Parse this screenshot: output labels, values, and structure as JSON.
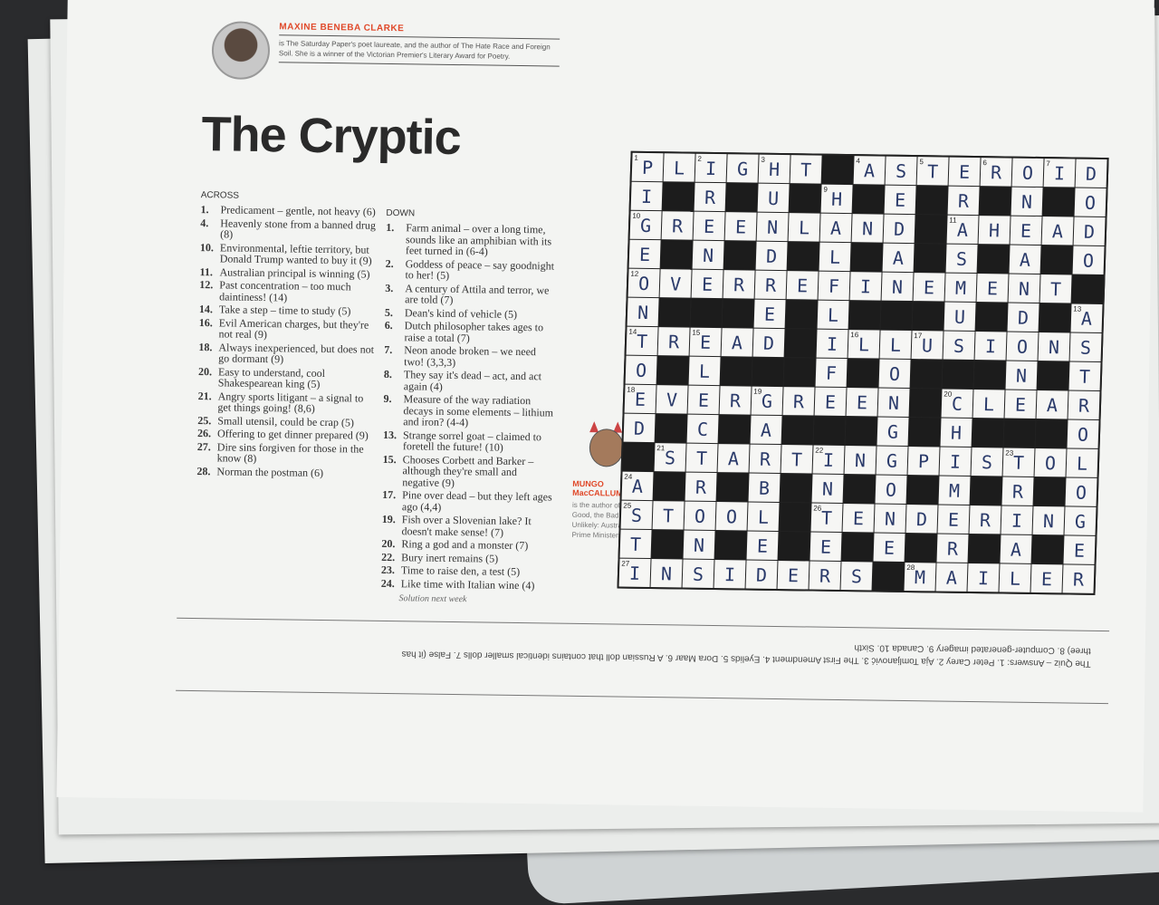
{
  "author": {
    "name": "MAXINE BENEBA CLARKE",
    "bio": "is The Saturday Paper's poet laureate, and the author of The Hate Race and Foreign Soil. She is a winner of the Victorian Premier's Literary Award for Poetry."
  },
  "title": "The Cryptic",
  "across_heading": "ACROSS",
  "down_heading": "DOWN",
  "across": [
    {
      "n": "1.",
      "t": "Predicament – gentle, not heavy (6)"
    },
    {
      "n": "4.",
      "t": "Heavenly stone from a banned drug (8)"
    },
    {
      "n": "10.",
      "t": "Environmental, leftie territory, but Donald Trump wanted to buy it (9)"
    },
    {
      "n": "11.",
      "t": "Australian principal is winning (5)"
    },
    {
      "n": "12.",
      "t": "Past concentration – too much daintiness! (14)"
    },
    {
      "n": "14.",
      "t": "Take a step – time to study (5)"
    },
    {
      "n": "16.",
      "t": "Evil American charges, but they're not real (9)"
    },
    {
      "n": "18.",
      "t": "Always inexperienced, but does not go dormant (9)"
    },
    {
      "n": "20.",
      "t": "Easy to understand, cool Shakespearean king (5)"
    },
    {
      "n": "21.",
      "t": "Angry sports litigant – a signal to get things going! (8,6)"
    },
    {
      "n": "25.",
      "t": "Small utensil, could be crap (5)"
    },
    {
      "n": "26.",
      "t": "Offering to get dinner prepared (9)"
    },
    {
      "n": "27.",
      "t": "Dire sins forgiven for those in the know (8)"
    },
    {
      "n": "28.",
      "t": "Norman the postman (6)"
    }
  ],
  "down": [
    {
      "n": "1.",
      "t": "Farm animal – over a long time, sounds like an amphibian with its feet turned in (6-4)"
    },
    {
      "n": "2.",
      "t": "Goddess of peace – say goodnight to her! (5)"
    },
    {
      "n": "3.",
      "t": "A century of Attila and terror, we are told (7)"
    },
    {
      "n": "5.",
      "t": "Dean's kind of vehicle (5)"
    },
    {
      "n": "6.",
      "t": "Dutch philosopher takes ages to raise a total (7)"
    },
    {
      "n": "7.",
      "t": "Neon anode broken – we need two! (3,3,3)"
    },
    {
      "n": "8.",
      "t": "They say it's dead – act, and act again (4)"
    },
    {
      "n": "9.",
      "t": "Measure of the way radiation decays in some elements – lithium and iron? (4-4)"
    },
    {
      "n": "13.",
      "t": "Strange sorrel goat – claimed to foretell the future! (10)"
    },
    {
      "n": "15.",
      "t": "Chooses Corbett and Barker – although they're small and negative (9)"
    },
    {
      "n": "17.",
      "t": "Pine over dead – but they left ages ago (4,4)"
    },
    {
      "n": "19.",
      "t": "Fish over a Slovenian lake? It doesn't make sense! (7)"
    },
    {
      "n": "20.",
      "t": "Ring a god and a monster (7)"
    },
    {
      "n": "22.",
      "t": "Bury inert remains (5)"
    },
    {
      "n": "23.",
      "t": "Time to raise den, a test (5)"
    },
    {
      "n": "24.",
      "t": "Like time with Italian wine (4)"
    }
  ],
  "setter": {
    "name_line1": "MUNGO",
    "name_line2": "MacCALLUM",
    "bio": "is the author of The Good, the Bad & the Unlikely: Australia's Prime Ministers."
  },
  "solution_note": "Solution next week",
  "quiz_answers": "The Quiz – Answers: 1. Peter Carey 2. Aja Tomljanović 3. The First Amendment 4. Eyelids 5. Dora Maar 6. A Russian doll that contains identical smaller dolls 7. False (it has three) 8. Computer-generated imagery 9. Canada 10. Sixth",
  "grid": {
    "rows": [
      "PLIGHT#ASTEROID",
      "I#R#U#H#E#R#N#O",
      "GREENLAND#AHEAD",
      "E#N#D#L#A#S#A#O",
      "OVERREFINEMENT#",
      "N###E#L###U#D#A",
      "TREAD#ILLUSIONS",
      "O#L###F#O###N#T",
      "EVERGREEN#CLEAR",
      "D#C#A###G#H###O",
      "#STARTINGPISTOL",
      "A#R#B#N#O#M#R#O",
      "STOOL#TENDERING",
      "T#N#E#E#E#R#A#E",
      "INSIDERS#MAILER"
    ],
    "numbers": {
      "0,0": "1",
      "0,2": "2",
      "0,4": "3",
      "0,7": "4",
      "0,9": "5",
      "0,11": "6",
      "0,13": "7",
      "0,15": "8",
      "1,6": "9",
      "2,0": "10",
      "2,10": "11",
      "4,0": "12",
      "5,14": "13",
      "6,0": "14",
      "6,2": "15",
      "6,7": "16",
      "6,9": "17",
      "8,0": "18",
      "8,4": "19",
      "8,10": "20",
      "10,1": "21",
      "10,6": "22",
      "10,12": "23",
      "11,0": "24",
      "12,0": "25",
      "12,6": "26",
      "14,0": "27",
      "14,9": "28"
    }
  }
}
